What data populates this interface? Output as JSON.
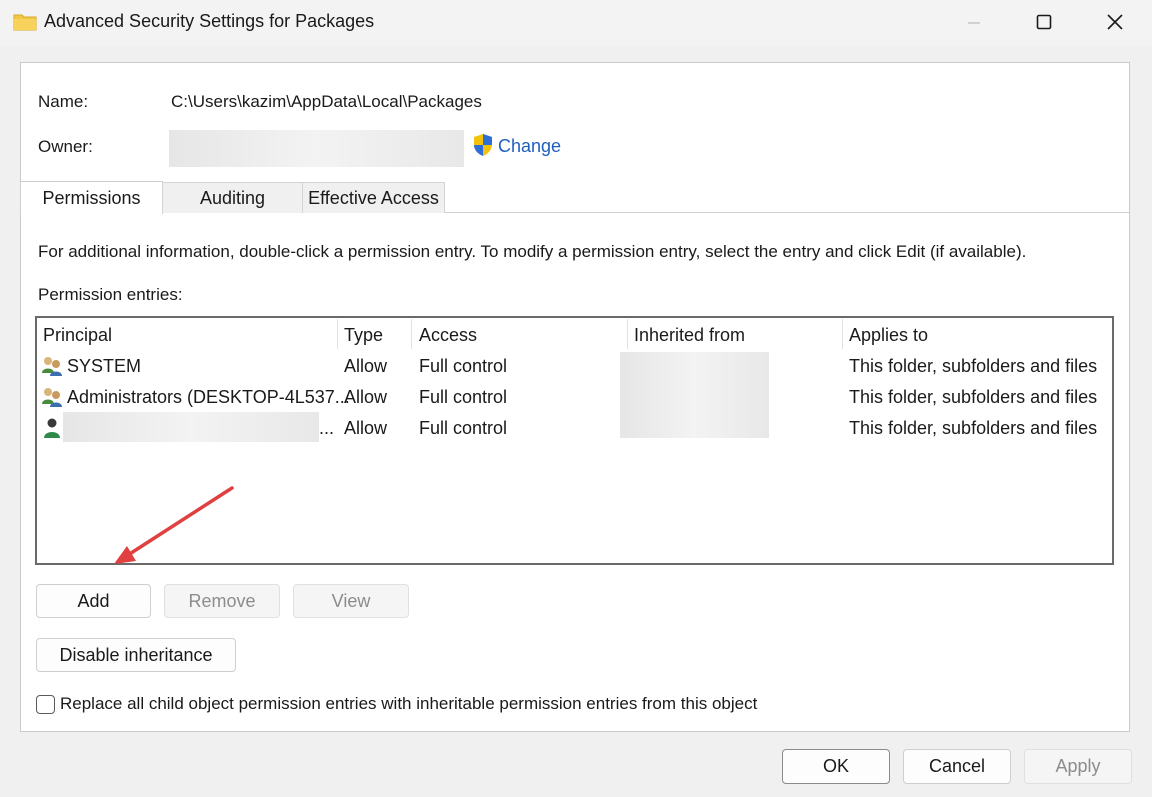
{
  "window": {
    "title": "Advanced Security Settings for Packages",
    "icon": "folder-icon"
  },
  "object": {
    "name_label": "Name:",
    "name_value": "C:\\Users\\kazim\\AppData\\Local\\Packages",
    "owner_label": "Owner:",
    "change_link": "Change"
  },
  "tabs": [
    {
      "label": "Permissions",
      "active": true
    },
    {
      "label": "Auditing",
      "active": false
    },
    {
      "label": "Effective Access",
      "active": false
    }
  ],
  "info_text": "For additional information, double-click a permission entry. To modify a permission entry, select the entry and click Edit (if available).",
  "entries_label": "Permission entries:",
  "table": {
    "columns": [
      "Principal",
      "Type",
      "Access",
      "Inherited from",
      "Applies to"
    ],
    "rows": [
      {
        "principal": "SYSTEM",
        "type": "Allow",
        "access": "Full control",
        "applies": "This folder, subfolders and files",
        "icon": "group-icon"
      },
      {
        "principal": "Administrators (DESKTOP-4L537...",
        "type": "Allow",
        "access": "Full control",
        "applies": "This folder, subfolders and files",
        "icon": "group-icon"
      },
      {
        "principal": "...",
        "type": "Allow",
        "access": "Full control",
        "applies": "This folder, subfolders and files",
        "icon": "user-icon"
      }
    ]
  },
  "buttons": {
    "add": "Add",
    "remove": "Remove",
    "view": "View",
    "disable_inheritance": "Disable inheritance",
    "ok": "OK",
    "cancel": "Cancel",
    "apply": "Apply"
  },
  "replace_checkbox": {
    "label": "Replace all child object permission entries with inheritable permission entries from this object",
    "checked": false
  },
  "colors": {
    "link": "#1f5fbf",
    "arrow": "#e04040",
    "folder": "#f2c744"
  }
}
